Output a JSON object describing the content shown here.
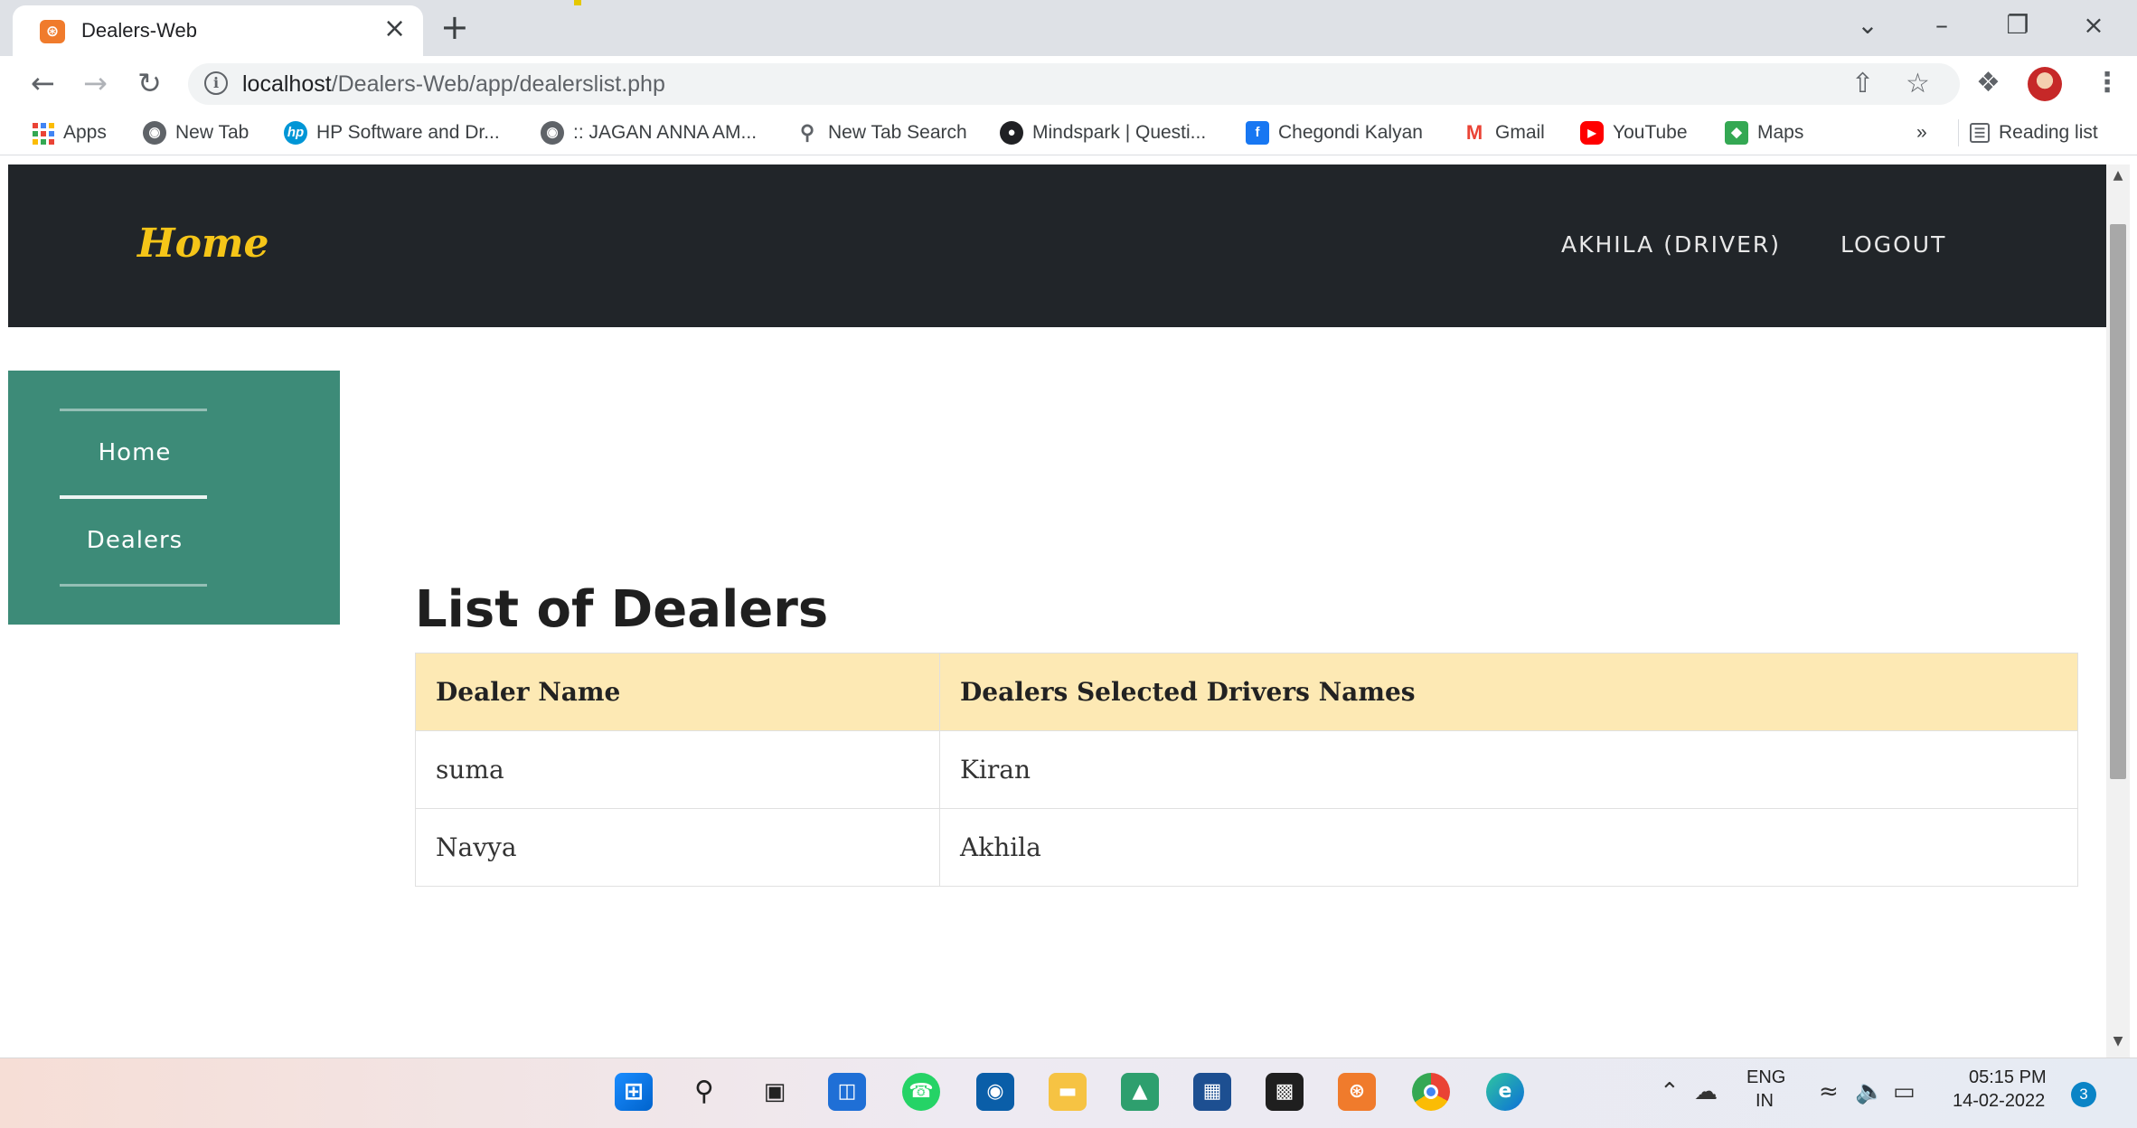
{
  "browser": {
    "tab_title": "Dealers-Web",
    "url_host": "localhost",
    "url_path": "/Dealers-Web/app/dealerslist.php",
    "bookmarks": [
      {
        "label": "Apps",
        "icon": "apps-grid-icon"
      },
      {
        "label": "New Tab",
        "icon": "chrome-icon"
      },
      {
        "label": "HP Software and Dr...",
        "icon": "hp-icon"
      },
      {
        "label": ":: JAGAN ANNA AM...",
        "icon": "chrome-icon"
      },
      {
        "label": "New Tab Search",
        "icon": "search-icon"
      },
      {
        "label": "Mindspark | Questi...",
        "icon": "mindspark-icon"
      },
      {
        "label": "Chegondi Kalyan",
        "icon": "facebook-icon"
      },
      {
        "label": "Gmail",
        "icon": "gmail-icon"
      },
      {
        "label": "YouTube",
        "icon": "youtube-icon"
      },
      {
        "label": "Maps",
        "icon": "maps-icon"
      }
    ],
    "overflow_label": "»",
    "reading_list": "Reading list"
  },
  "navbar": {
    "brand": "Home",
    "user_link": "AKHILA (DRIVER)",
    "logout": "LOGOUT"
  },
  "sidebar": {
    "items": [
      {
        "label": "Home"
      },
      {
        "label": "Dealers"
      }
    ]
  },
  "main": {
    "title": "List of Dealers",
    "table": {
      "headers": [
        "Dealer Name",
        "Dealers Selected Drivers Names"
      ],
      "rows": [
        [
          "suma",
          "Kiran"
        ],
        [
          "Navya",
          "Akhila"
        ]
      ]
    }
  },
  "taskbar": {
    "lang_top": "ENG",
    "lang_bottom": "IN",
    "time": "05:15 PM",
    "date": "14-02-2022",
    "notifications": "3"
  },
  "colors": {
    "navbar_bg": "#212529",
    "brand": "#f5c518",
    "sidebar_bg": "#3d8b78",
    "table_header_bg": "#fde9b4"
  }
}
